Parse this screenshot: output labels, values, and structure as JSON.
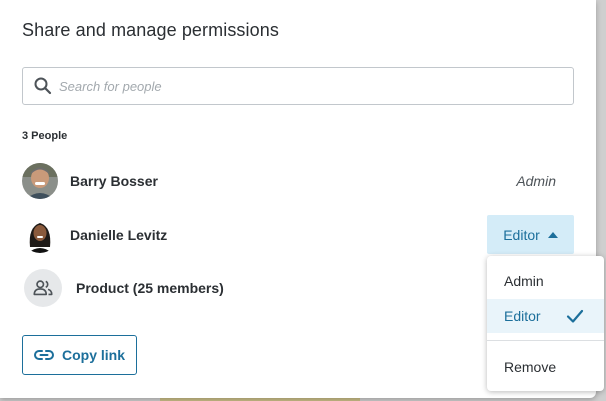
{
  "dialog": {
    "title": "Share and manage permissions"
  },
  "search": {
    "placeholder": "Search for people",
    "value": ""
  },
  "people": {
    "count_label": "3 People",
    "list": [
      {
        "name": "Barry Bosser",
        "role": "Admin"
      },
      {
        "name": "Danielle Levitz",
        "role": "Editor"
      },
      {
        "name": "Product (25 members)",
        "role": ""
      }
    ]
  },
  "copy_link": {
    "label": "Copy link"
  },
  "role_menu": {
    "options": [
      "Admin",
      "Editor",
      "Remove"
    ],
    "selected": "Editor"
  },
  "colors": {
    "accent": "#1c6f9b",
    "selected_bg": "#d4ecf8",
    "text": "#2b2f33"
  },
  "icons": {
    "search": "search-icon",
    "group": "group-icon",
    "link": "link-icon",
    "check": "checkmark-icon",
    "caret": "caret-up-icon"
  }
}
